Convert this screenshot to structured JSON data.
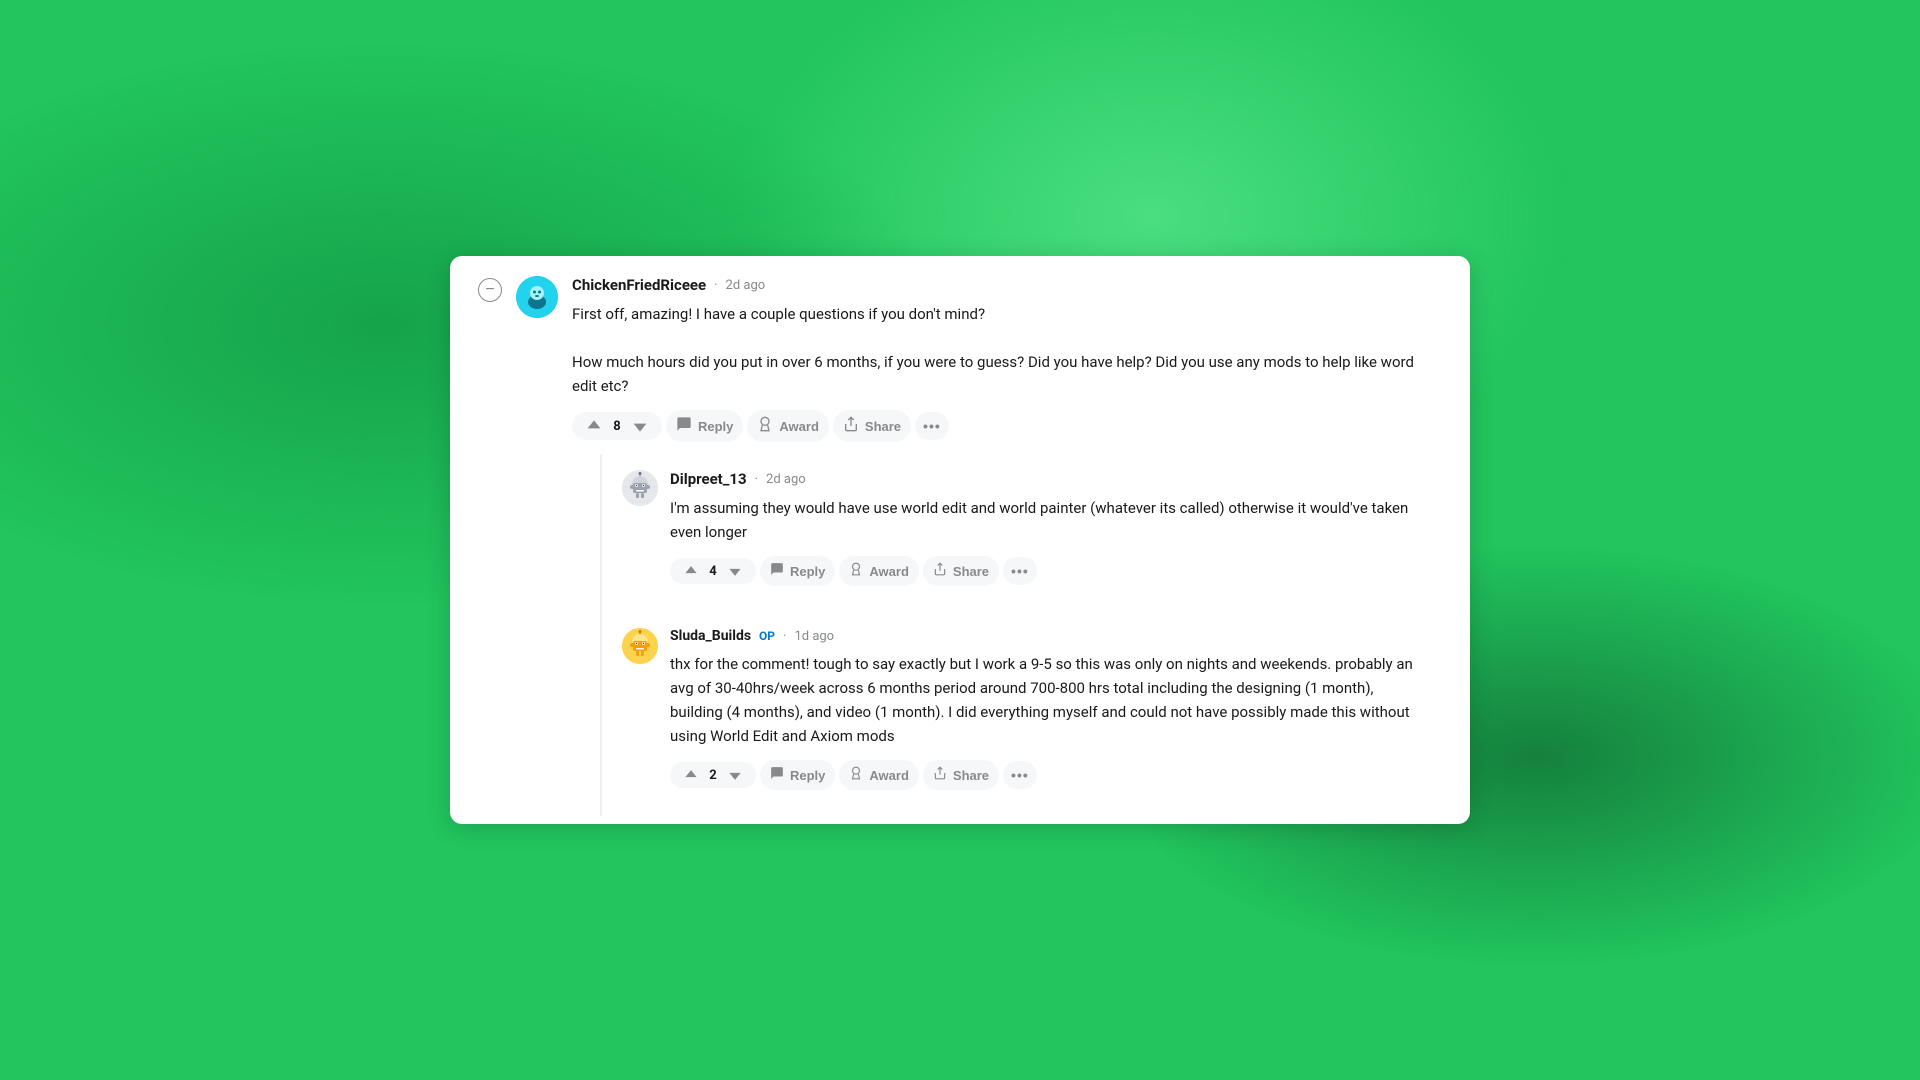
{
  "background": {
    "color": "#22c55e"
  },
  "comments": [
    {
      "id": "comment-1",
      "username": "ChickenFriedRiceee",
      "timestamp": "2d ago",
      "avatar_type": "chicken",
      "op": false,
      "text_lines": [
        "First off, amazing! I have a couple questions if you don't mind?",
        "How much hours did you put in over 6 months, if you were to guess? Did you have help? Did you use any mods to help like word edit etc?"
      ],
      "votes": 8,
      "actions": {
        "reply": "Reply",
        "award": "Award",
        "share": "Share",
        "more": "..."
      },
      "replies": [
        {
          "id": "reply-1",
          "username": "Dilpreet_13",
          "timestamp": "2d ago",
          "avatar_type": "robot",
          "op": false,
          "text": "I'm assuming they would have use world edit and world painter (whatever its called) otherwise it would've taken even longer",
          "votes": 4,
          "actions": {
            "reply": "Reply",
            "award": "Award",
            "share": "Share",
            "more": "..."
          }
        },
        {
          "id": "reply-2",
          "username": "Sluda_Builds",
          "timestamp": "1d ago",
          "avatar_type": "yellow",
          "op": true,
          "op_label": "OP",
          "text": "thx for the comment! tough to say exactly but I work a 9-5 so this was only on nights and weekends. probably an avg of 30-40hrs/week across 6 months period around 700-800 hrs total including the designing (1 month), building (4 months), and video (1 month). I did everything myself and could not have possibly made this without using World Edit and Axiom mods",
          "votes": 2,
          "actions": {
            "reply": "Reply",
            "award": "Award",
            "share": "Share",
            "more": "..."
          }
        }
      ]
    }
  ],
  "icons": {
    "upvote": "↑",
    "downvote": "↓",
    "reply_icon": "💬",
    "award_icon": "🏆",
    "share_icon": "↗",
    "more_icon": "•••",
    "collapse_icon": "−"
  }
}
